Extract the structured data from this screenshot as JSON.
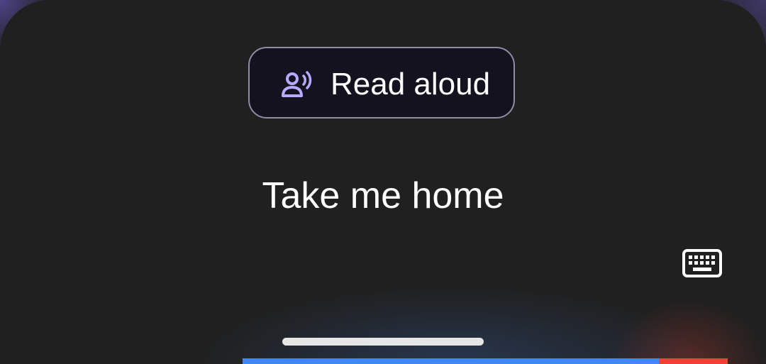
{
  "read_aloud": {
    "label": "Read aloud",
    "icon": "speaking-person-icon",
    "icon_color": "#b5aaff"
  },
  "transcript": {
    "text": "Take me home"
  },
  "keyboard": {
    "icon": "keyboard-icon"
  },
  "colors": {
    "sheet_background": "#202020",
    "button_background": "#14121f",
    "button_border": "#8f8ca3",
    "text": "#ffffff",
    "listening_blue": "#4285f4",
    "listening_red": "#ea4335"
  }
}
